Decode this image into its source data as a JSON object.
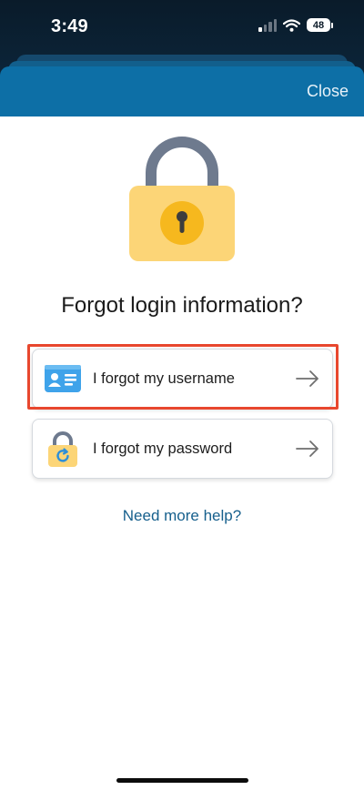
{
  "status_bar": {
    "time": "3:49",
    "battery": "48"
  },
  "header": {
    "close_label": "Close"
  },
  "main": {
    "title": "Forgot login information?",
    "options": [
      {
        "label": "I forgot my username",
        "icon": "id-card-icon",
        "highlighted": true
      },
      {
        "label": "I forgot my password",
        "icon": "lock-reset-icon",
        "highlighted": false
      }
    ],
    "help_link": "Need more help?"
  },
  "colors": {
    "header_blue": "#0d6fa6",
    "link_blue": "#17608d",
    "highlight_red": "#e8472e",
    "lock_yellow": "#fcd577"
  }
}
